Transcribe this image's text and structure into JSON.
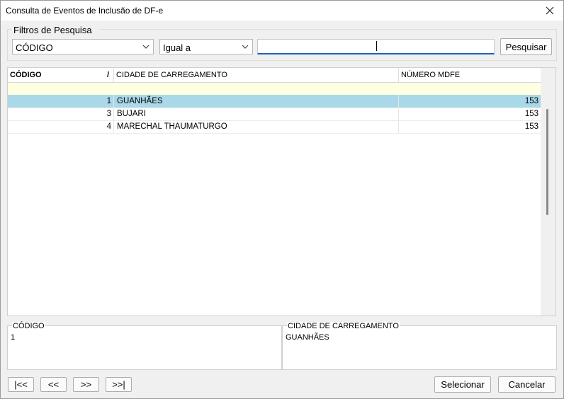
{
  "window": {
    "title": "Consulta de Eventos de Inclusão de DF-e"
  },
  "filters": {
    "group_label": "Filtros de Pesquisa",
    "field_value": "CÓDIGO",
    "operator_value": "Igual a",
    "search_value": "",
    "search_button": "Pesquisar"
  },
  "grid": {
    "columns": [
      "CÓDIGO",
      "CIDADE DE CARREGAMENTO",
      "NÚMERO MDFE"
    ],
    "sort_indicator": "/",
    "rows": [
      {
        "codigo": "1",
        "cidade": "GUANHÃES",
        "numero": "153",
        "selected": true
      },
      {
        "codigo": "3",
        "cidade": "BUJARI",
        "numero": "153",
        "selected": false
      },
      {
        "codigo": "4",
        "cidade": "MARECHAL THAUMATURGO",
        "numero": "153",
        "selected": false
      }
    ]
  },
  "detail": {
    "codigo_label": "CÓDIGO",
    "codigo_value": "1",
    "cidade_label": "CIDADE DE CARREGAMENTO",
    "cidade_value": "GUANHÃES"
  },
  "nav": {
    "first": "|<<",
    "prev": "<<",
    "next": ">>",
    "last": ">>|"
  },
  "actions": {
    "select": "Selecionar",
    "cancel": "Cancelar"
  },
  "colors": {
    "selected_row": "#a9d8e8",
    "filter_row": "#ffffe1",
    "input_focus": "#1a63b5"
  }
}
